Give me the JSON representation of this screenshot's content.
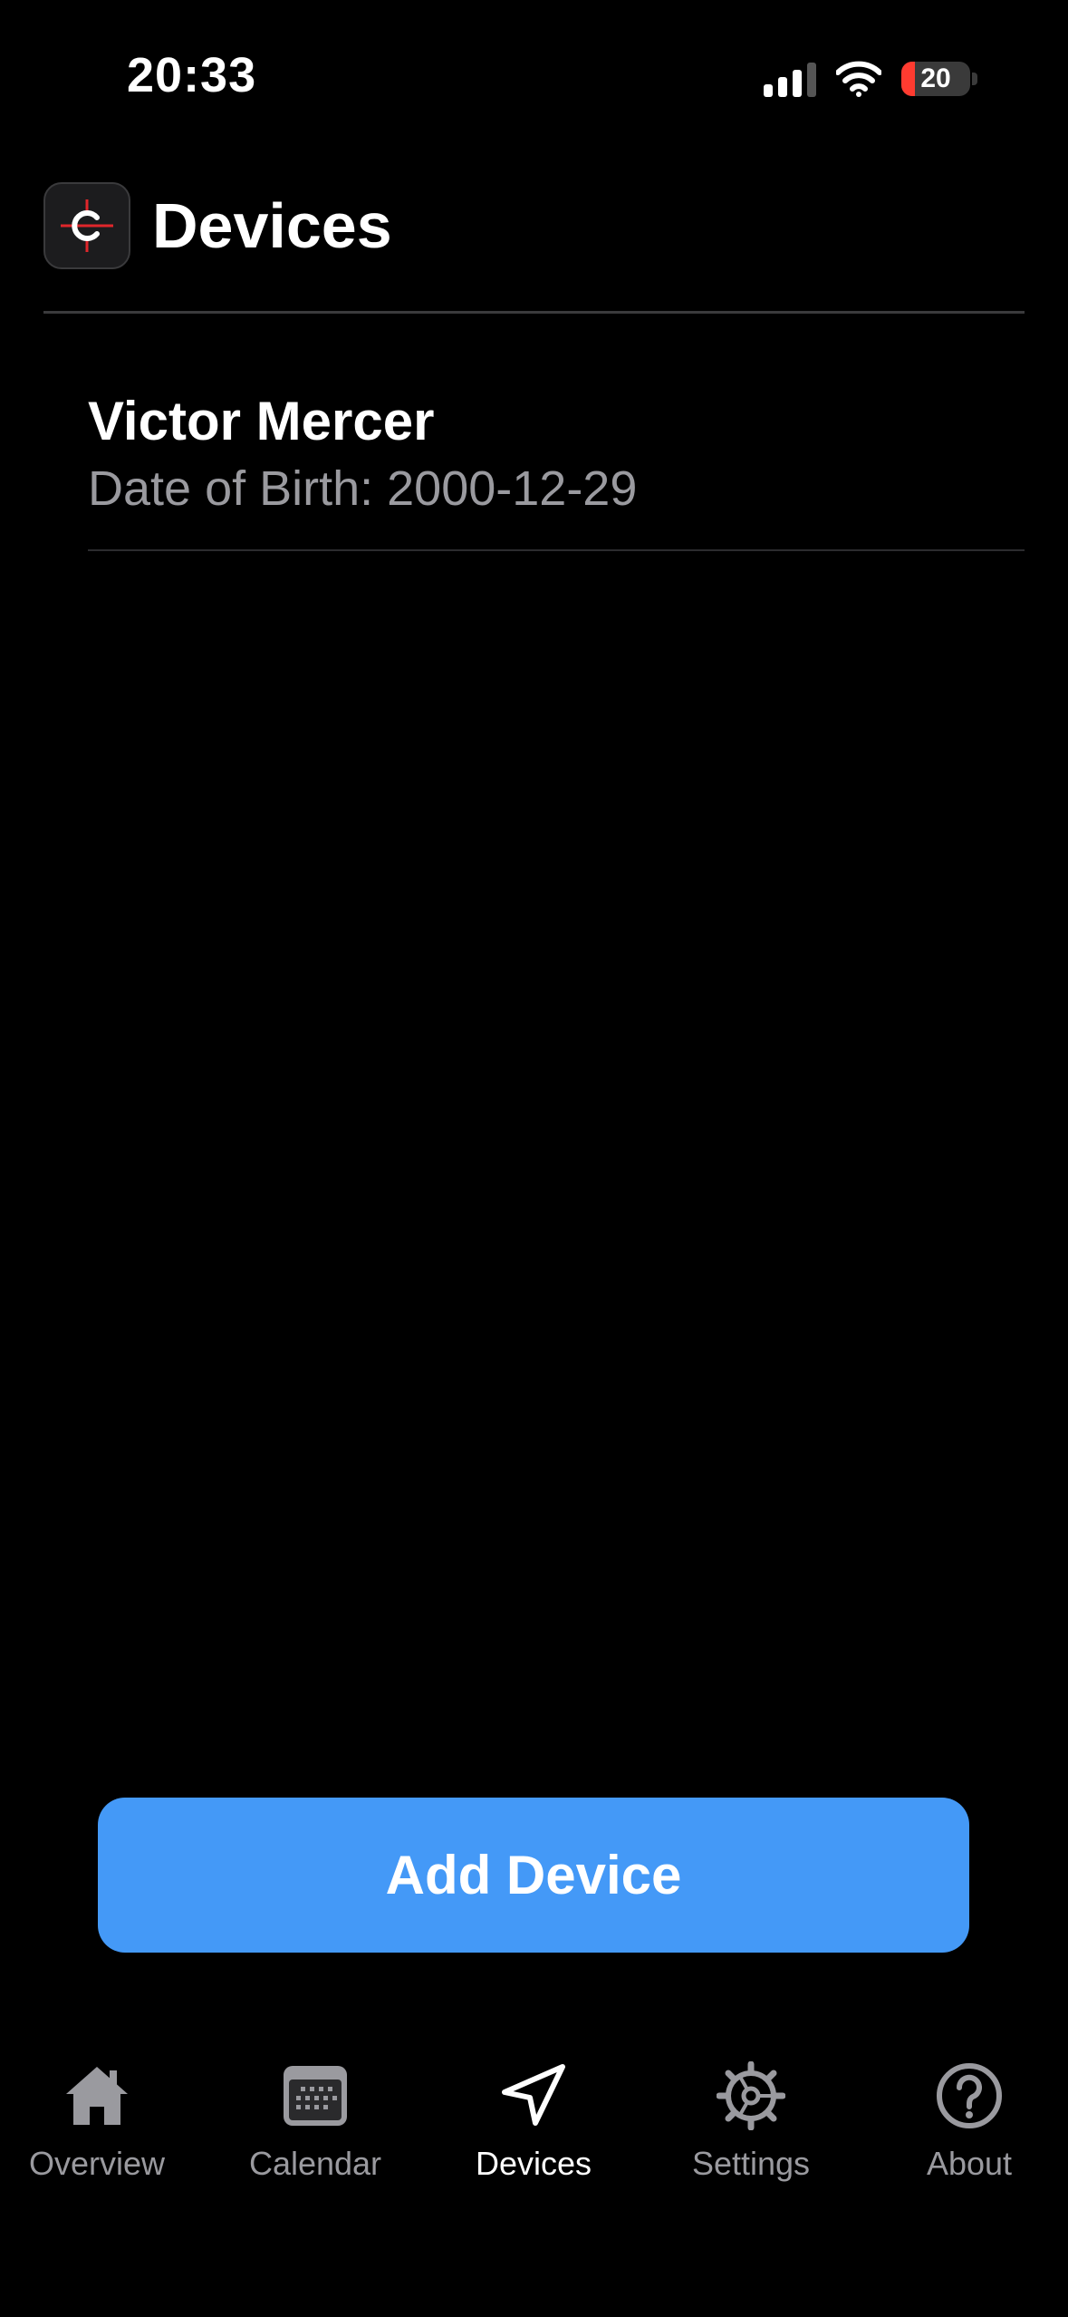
{
  "status_bar": {
    "time": "20:33",
    "battery": "20"
  },
  "header": {
    "title": "Devices"
  },
  "devices": [
    {
      "name": "Victor Mercer",
      "dob": "Date of Birth: 2000-12-29"
    }
  ],
  "add_button": {
    "label": "Add Device",
    "color": "#4499f7"
  },
  "tabs": [
    {
      "label": "Overview",
      "icon": "house-icon"
    },
    {
      "label": "Calendar",
      "icon": "calendar-icon"
    },
    {
      "label": "Devices",
      "icon": "location-arrow-icon",
      "active": true
    },
    {
      "label": "Settings",
      "icon": "gear-icon"
    },
    {
      "label": "About",
      "icon": "question-circle-icon"
    }
  ]
}
